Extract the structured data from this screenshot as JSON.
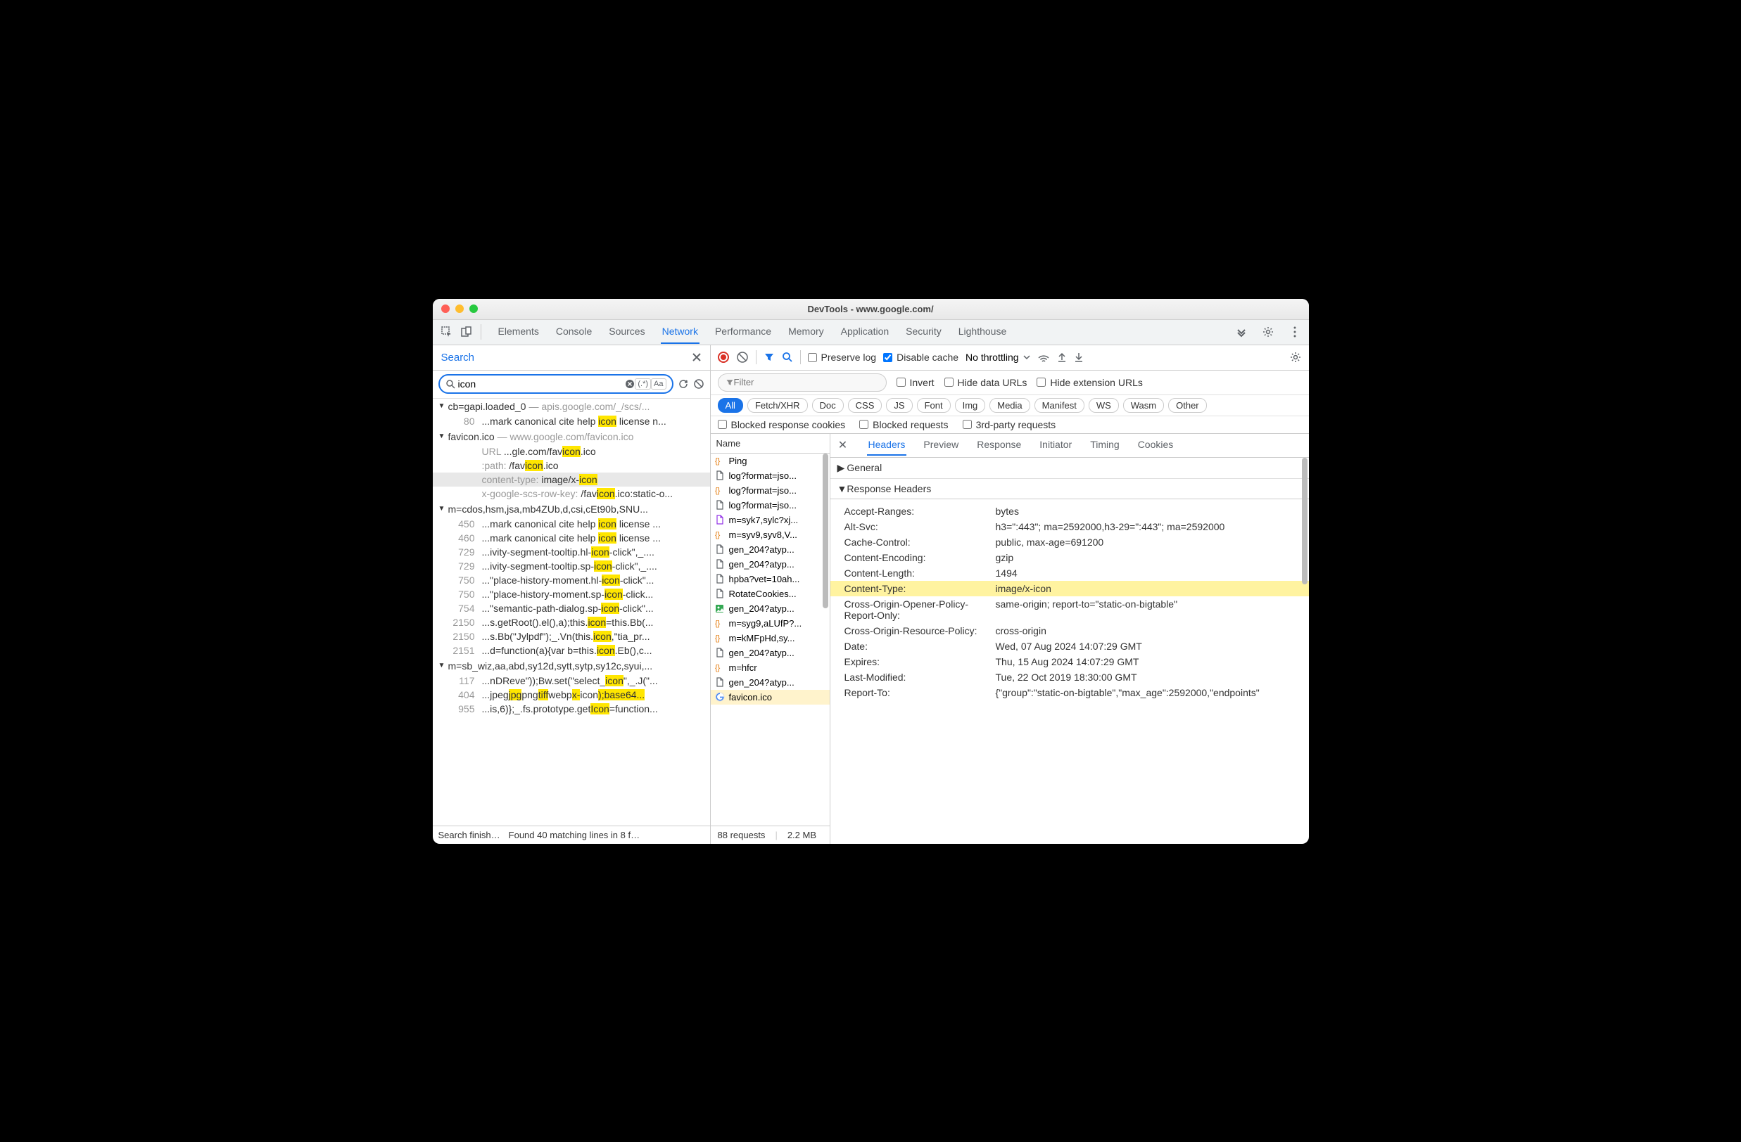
{
  "window": {
    "title": "DevTools - www.google.com/"
  },
  "main_tabs": [
    "Elements",
    "Console",
    "Sources",
    "Network",
    "Performance",
    "Memory",
    "Application",
    "Security",
    "Lighthouse"
  ],
  "main_tab_active": "Network",
  "search": {
    "title": "Search",
    "query": "icon",
    "footer_left": "Search finish…",
    "footer_right": "Found 40 matching lines in 8 f…"
  },
  "search_groups": [
    {
      "name": "cb=gapi.loaded_0",
      "path": "— apis.google.com/_/scs/...",
      "lines": [
        {
          "no": "80",
          "text": "...mark canonical cite help |icon| license n..."
        }
      ]
    },
    {
      "name": "favicon.ico",
      "path": "— www.google.com/favicon.ico",
      "lines": [
        {
          "no": "",
          "key": "URL",
          "text": "...gle.com/fav|icon|.ico"
        },
        {
          "no": "",
          "key": ":path:",
          "text": "/fav|icon|.ico"
        },
        {
          "no": "",
          "key": "content-type:",
          "text": "image/x-|icon|",
          "sel": true
        },
        {
          "no": "",
          "key": "x-google-scs-row-key:",
          "text": "/fav|icon|.ico:static-o..."
        }
      ]
    },
    {
      "name": "m=cdos,hsm,jsa,mb4ZUb,d,csi,cEt90b,SNU...",
      "path": "",
      "lines": [
        {
          "no": "450",
          "text": "...mark canonical cite help |icon| license ..."
        },
        {
          "no": "460",
          "text": "...mark canonical cite help |icon| license ..."
        },
        {
          "no": "729",
          "text": "...ivity-segment-tooltip.hl-|icon|-click\",_...."
        },
        {
          "no": "729",
          "text": "...ivity-segment-tooltip.sp-|icon|-click\",_...."
        },
        {
          "no": "750",
          "text": "...\"place-history-moment.hl-|icon|-click\"..."
        },
        {
          "no": "750",
          "text": "...\"place-history-moment.sp-|icon|-click..."
        },
        {
          "no": "754",
          "text": "...\"semantic-path-dialog.sp-|icon|-click\"..."
        },
        {
          "no": "2150",
          "text": "...s.getRoot().el(),a);this.|icon|=this.Bb(..."
        },
        {
          "no": "2150",
          "text": "...s.Bb(\"Jylpdf\");_.Vn(this.|icon|,\"tia_pr..."
        },
        {
          "no": "2151",
          "text": "...d=function(a){var b=this.|icon|.Eb(),c..."
        }
      ]
    },
    {
      "name": "m=sb_wiz,aa,abd,sy12d,sytt,sytp,sy12c,syui,...",
      "path": "",
      "lines": [
        {
          "no": "117",
          "text": "...nDReve\"));Bw.set(\"select_|icon|\",_.J(\"..."
        },
        {
          "no": "404",
          "text": "...jpeg|jpg|png|tiff|webp|x-|icon|);base64..."
        },
        {
          "no": "955",
          "text": "...is,6)};_.fs.prototype.get|Icon|=function..."
        }
      ]
    }
  ],
  "net_toolbar": {
    "preserve": "Preserve log",
    "disable_cache": "Disable cache",
    "throttling": "No throttling"
  },
  "filter": {
    "placeholder": "Filter",
    "invert": "Invert",
    "hide_data": "Hide data URLs",
    "hide_ext": "Hide extension URLs"
  },
  "type_chips": [
    "All",
    "Fetch/XHR",
    "Doc",
    "CSS",
    "JS",
    "Font",
    "Img",
    "Media",
    "Manifest",
    "WS",
    "Wasm",
    "Other"
  ],
  "type_chip_active": "All",
  "block_row": {
    "cookies": "Blocked response cookies",
    "requests": "Blocked requests",
    "third": "3rd-party requests"
  },
  "name_col": {
    "header": "Name",
    "rows": [
      {
        "icon": "fetch",
        "name": "Ping"
      },
      {
        "icon": "doc",
        "name": "log?format=jso..."
      },
      {
        "icon": "fetch",
        "name": "log?format=jso..."
      },
      {
        "icon": "doc",
        "name": "log?format=jso..."
      },
      {
        "icon": "script",
        "name": "m=syk7,sylc?xj..."
      },
      {
        "icon": "fetch",
        "name": "m=syv9,syv8,V..."
      },
      {
        "icon": "doc",
        "name": "gen_204?atyp..."
      },
      {
        "icon": "doc",
        "name": "gen_204?atyp..."
      },
      {
        "icon": "doc",
        "name": "hpba?vet=10ah..."
      },
      {
        "icon": "doc",
        "name": "RotateCookies..."
      },
      {
        "icon": "img",
        "name": "gen_204?atyp..."
      },
      {
        "icon": "fetch",
        "name": "m=syg9,aLUfP?..."
      },
      {
        "icon": "fetch",
        "name": "m=kMFpHd,sy..."
      },
      {
        "icon": "doc",
        "name": "gen_204?atyp..."
      },
      {
        "icon": "fetch",
        "name": "m=hfcr"
      },
      {
        "icon": "doc",
        "name": "gen_204?atyp..."
      },
      {
        "icon": "g",
        "name": "favicon.ico",
        "sel": true
      }
    ],
    "footer_requests": "88 requests",
    "footer_size": "2.2 MB"
  },
  "detail_tabs": [
    "Headers",
    "Preview",
    "Response",
    "Initiator",
    "Timing",
    "Cookies"
  ],
  "detail_tab_active": "Headers",
  "detail_sections": {
    "general": "General",
    "response": "Response Headers"
  },
  "response_headers": [
    {
      "k": "Accept-Ranges:",
      "v": "bytes"
    },
    {
      "k": "Alt-Svc:",
      "v": "h3=\":443\"; ma=2592000,h3-29=\":443\"; ma=2592000"
    },
    {
      "k": "Cache-Control:",
      "v": "public, max-age=691200"
    },
    {
      "k": "Content-Encoding:",
      "v": "gzip"
    },
    {
      "k": "Content-Length:",
      "v": "1494"
    },
    {
      "k": "Content-Type:",
      "v": "image/x-icon",
      "hl": true
    },
    {
      "k": "Cross-Origin-Opener-Policy-Report-Only:",
      "v": "same-origin; report-to=\"static-on-bigtable\""
    },
    {
      "k": "Cross-Origin-Resource-Policy:",
      "v": "cross-origin"
    },
    {
      "k": "Date:",
      "v": "Wed, 07 Aug 2024 14:07:29 GMT"
    },
    {
      "k": "Expires:",
      "v": "Thu, 15 Aug 2024 14:07:29 GMT"
    },
    {
      "k": "Last-Modified:",
      "v": "Tue, 22 Oct 2019 18:30:00 GMT"
    },
    {
      "k": "Report-To:",
      "v": "{\"group\":\"static-on-bigtable\",\"max_age\":2592000,\"endpoints\""
    }
  ]
}
